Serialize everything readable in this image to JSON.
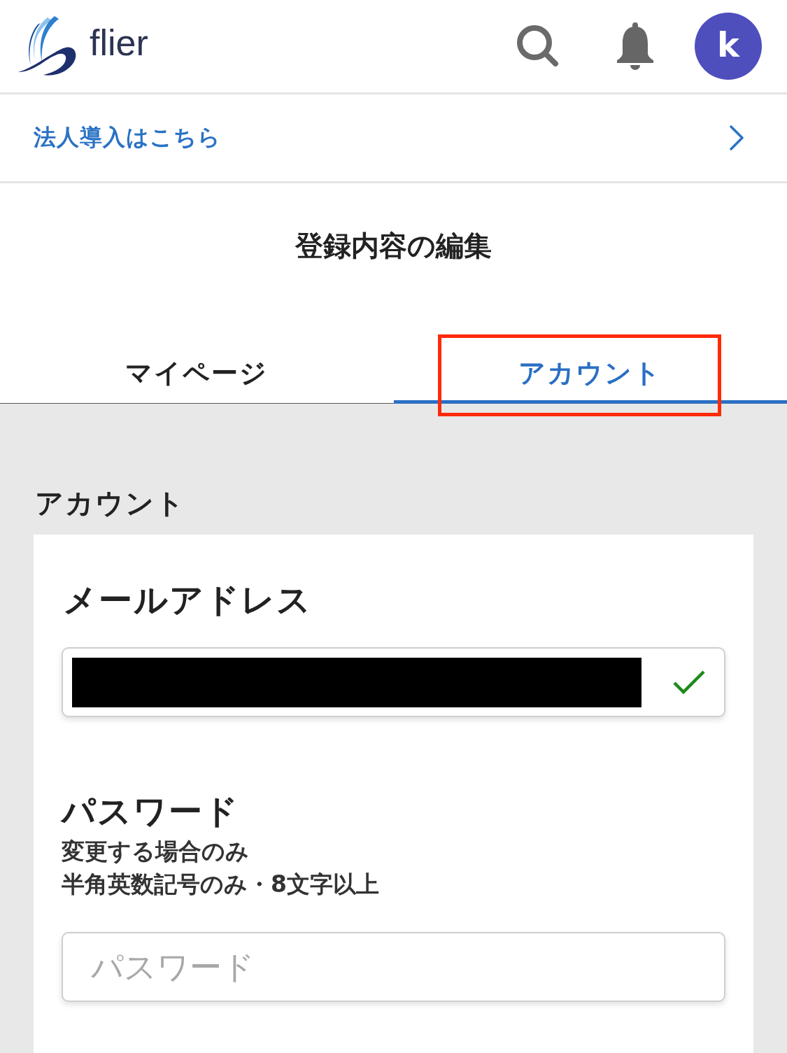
{
  "header": {
    "logo_text": "flier",
    "avatar_letter": "k"
  },
  "corporate_link": {
    "label": "法人導入はこちら"
  },
  "page_title": "登録内容の編集",
  "tabs": [
    {
      "label": "マイページ",
      "selected": false,
      "highlighted": false
    },
    {
      "label": "アカウント",
      "selected": true,
      "highlighted": true
    }
  ],
  "section": {
    "title": "アカウント",
    "fields": [
      {
        "kind": "email",
        "label": "メールアドレス",
        "redacted": true,
        "valid": true
      },
      {
        "kind": "password",
        "label": "パスワード",
        "notes": [
          "変更する場合のみ",
          "半角英数記号のみ・8文字以上"
        ],
        "placeholder": "パスワード"
      }
    ]
  }
}
